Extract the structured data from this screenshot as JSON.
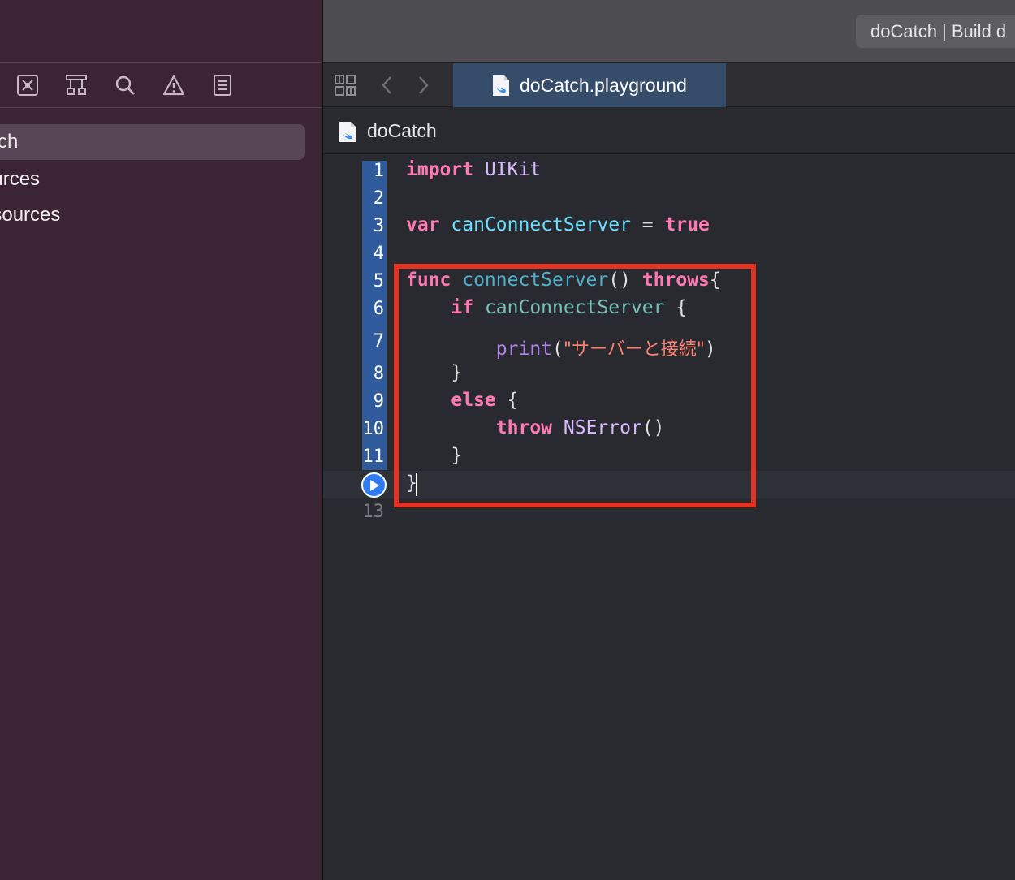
{
  "sidebar": {
    "items": [
      {
        "label": "atch",
        "selected": true
      },
      {
        "label": "ources",
        "selected": false
      },
      {
        "label": "esources",
        "selected": false
      }
    ],
    "navigator_icons": [
      "source-control-icon",
      "hierarchy-icon",
      "search-icon",
      "warning-icon",
      "list-icon"
    ]
  },
  "titlebar": {
    "activity": "doCatch | Build d"
  },
  "tabbar": {
    "tab_label": "doCatch.playground",
    "icons": [
      "grid-icon",
      "chevron-left-icon",
      "chevron-right-icon",
      "swift-file-icon"
    ]
  },
  "jumpbar": {
    "label": "doCatch"
  },
  "editor": {
    "line_numbers": [
      "1",
      "2",
      "3",
      "4",
      "5",
      "6",
      "7",
      "8",
      "9",
      "10",
      "11",
      "",
      "13"
    ],
    "code": {
      "l1": {
        "kw": "import",
        "rest": " UIKit"
      },
      "l3": {
        "kw": "var",
        "name": " canConnectServer",
        "op": " = ",
        "val": "true"
      },
      "l5": {
        "kw": "func",
        "name": " connectServer",
        "paren": "()",
        "kw2": " throws",
        "brace": "{"
      },
      "l6": {
        "indent": "    ",
        "kw": "if",
        "name": " canConnectServer",
        "brace": " {"
      },
      "l7": {
        "indent": "        ",
        "fn": "print",
        "open": "(",
        "str": "\"サーバーと接続\"",
        "close": ")"
      },
      "l8": {
        "text": "    }"
      },
      "l9": {
        "indent": "    ",
        "kw": "else",
        "brace": " {"
      },
      "l10": {
        "indent": "        ",
        "kw": "throw",
        "type": " NSError",
        "paren": "()"
      },
      "l11": {
        "text": "    }"
      },
      "l12": {
        "text": "}"
      }
    },
    "colors": {
      "keyword": "#ff7ab2",
      "string": "#ff8170",
      "type": "#dabaff",
      "annotation_box": "#e53323",
      "gutter_highlight": "#2f5a9b"
    }
  }
}
